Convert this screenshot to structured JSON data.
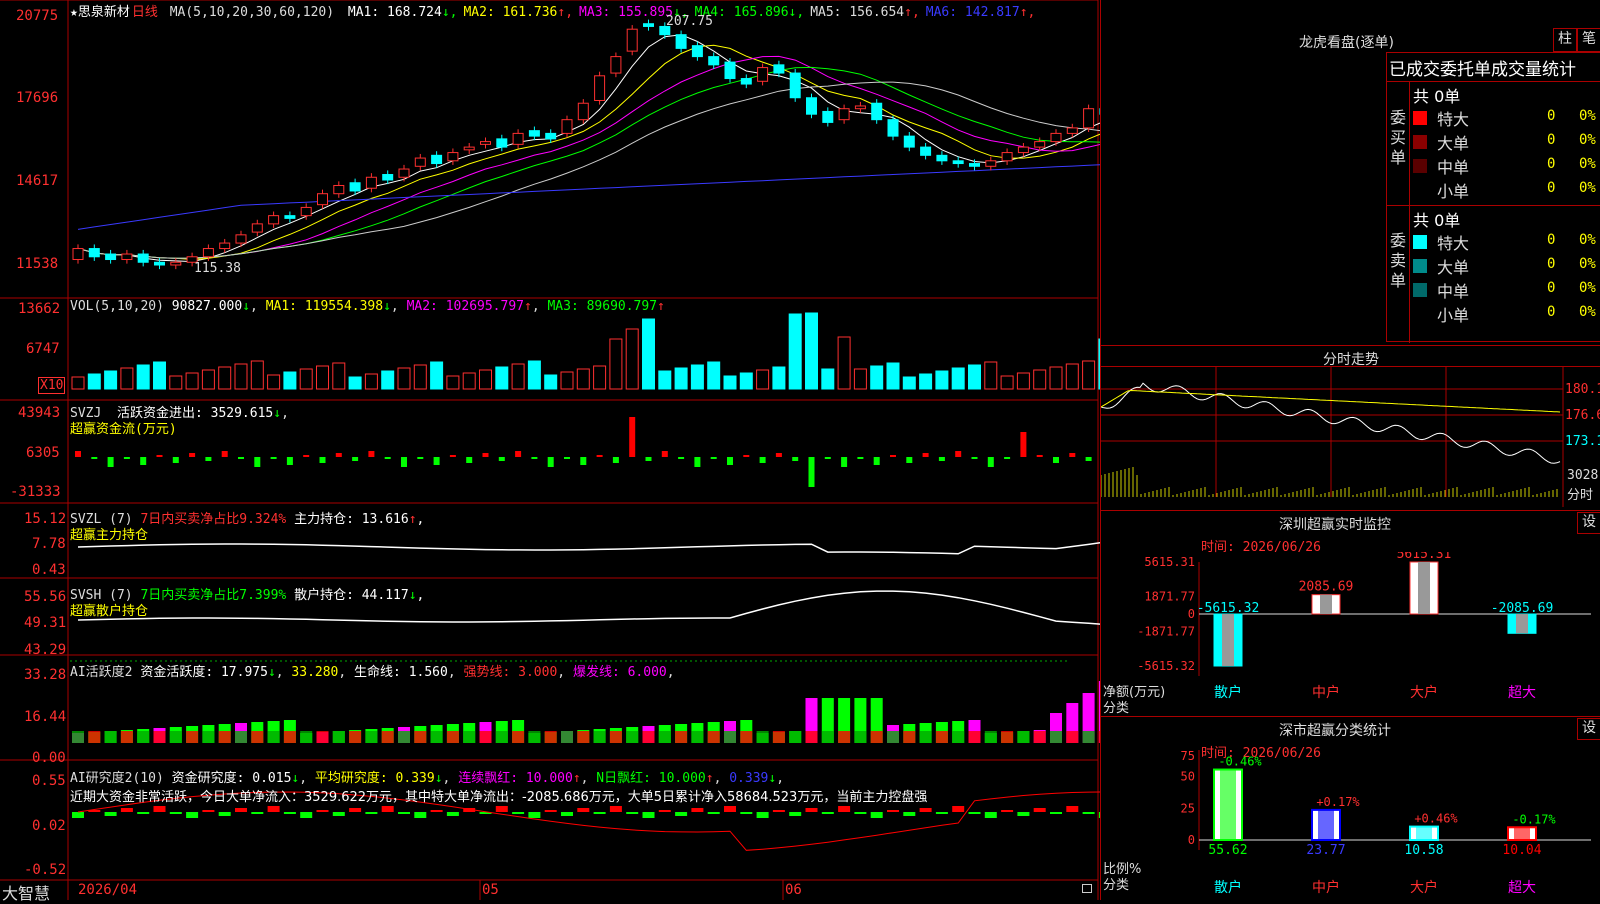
{
  "header": {
    "star": "★",
    "stock_name": "思泉新材",
    "period": "日线",
    "ma_label": "MA(5,10,20,30,60,120)",
    "ma_values": [
      {
        "label": "MA1: 168.724",
        "arrow": "↓",
        "color": "#ffffff"
      },
      {
        "label": "MA2: 161.736",
        "arrow": "↑",
        "color": "#ffff00"
      },
      {
        "label": "MA3: 155.895",
        "arrow": "↓",
        "color": "#ff00ff"
      },
      {
        "label": "MA4: 165.896",
        "arrow": "↓",
        "color": "#00ff00"
      },
      {
        "label": "MA5: 156.654",
        "arrow": "↑",
        "color": "#dddddd"
      },
      {
        "label": "MA6: 142.817",
        "arrow": "↑",
        "color": "#3a3aff"
      }
    ]
  },
  "axes": {
    "price": [
      "20775",
      "17696",
      "14617",
      "11538"
    ],
    "vol": [
      "13662",
      "6747"
    ],
    "vol_unit": "X10",
    "svzj": [
      "43943",
      "6305",
      "-31333"
    ],
    "svzl": [
      "15.12",
      "7.78",
      "0.43"
    ],
    "svsh": [
      "55.56",
      "49.31",
      "43.29"
    ],
    "ai": [
      "33.28",
      "16.44",
      "0.00"
    ],
    "ai2": [
      "0.55",
      "0.02",
      "-0.52"
    ]
  },
  "annotations": {
    "high": "207.75",
    "low": "115.38"
  },
  "panels": {
    "vol": {
      "title": "VOL(5,10,20)",
      "value": "90827.000",
      "arrow": "↓",
      "ma1": "MA1: 119554.398",
      "ma1_arrow": "↓",
      "ma2": "MA2: 102695.797",
      "ma2_arrow": "↑",
      "ma3": "MA3: 89690.797",
      "ma3_arrow": "↑"
    },
    "svzj": {
      "title": "SVZJ",
      "label": "活跃资金进出: 3529.615",
      "arrow": "↓",
      "subtitle": "超赢资金流(万元)"
    },
    "svzl": {
      "title": "SVZL (7)",
      "ratio": "7日内买卖净占比9.324%",
      "label": "主力持仓: 13.616",
      "arrow": "↑",
      "suffix": ",",
      "subtitle": "超赢主力持仓"
    },
    "svsh": {
      "title": "SVSH (7)",
      "ratio": "7日内买卖净占比7.399%",
      "label": "散户持仓: 44.117",
      "arrow": "↓",
      "suffix": ",",
      "subtitle": "超赢散户持仓"
    },
    "ai": {
      "title": "AI活跃度2",
      "a": "资金活跃度: 17.975",
      "a_arrow": "↓",
      "b": "33.280",
      "c": "生命线: 1.560",
      "d": "强势线: 3.000",
      "e": "爆发线: 6.000"
    },
    "ai2": {
      "title": "AI研究度2(10)",
      "a": "资金研究度: 0.015",
      "a_arrow": "↓",
      "b": "平均研究度: 0.339",
      "b_arrow": "↓",
      "c": "连续飘红: 10.000",
      "c_arrow": "↑",
      "d": "N日飘红: 10.000",
      "d_arrow": "↑",
      "e": "0.339",
      "e_arrow": "↓",
      "comment": "近期大资金非常活跃，今日大单净流入：3529.622万元，其中特大单净流出：-2085.686万元，大单5日累计净入58684.523万元，当前主力控盘强"
    }
  },
  "bottom": {
    "brand": "大智慧",
    "date_start": "2026/04",
    "m5": "05",
    "m6": "06"
  },
  "right": {
    "dragon_title": "龙虎看盘(逐单)",
    "btn_bar": "柱",
    "btn_line": "笔",
    "stats_title": "已成交委托单成交量统计",
    "buy_label": "委买单",
    "sell_label": "委卖单",
    "buy_total": "共 0单",
    "sell_total": "共 0单",
    "buy_rows": [
      {
        "name": "特大",
        "count": "0",
        "pct": "0%",
        "color": "#ff0000"
      },
      {
        "name": "大单",
        "count": "0",
        "pct": "0%",
        "color": "#8b0000"
      },
      {
        "name": "中单",
        "count": "0",
        "pct": "0%",
        "color": "#5a0000"
      },
      {
        "name": "小单",
        "count": "0",
        "pct": "0%",
        "color": ""
      }
    ],
    "sell_rows": [
      {
        "name": "特大",
        "count": "0",
        "pct": "0%",
        "color": "#00ffff"
      },
      {
        "name": "大单",
        "count": "0",
        "pct": "0%",
        "color": "#008b8b"
      },
      {
        "name": "中单",
        "count": "0",
        "pct": "0%",
        "color": "#006a6a"
      },
      {
        "name": "小单",
        "count": "0",
        "pct": "0%",
        "color": ""
      }
    ],
    "intraday_title": "分时走势",
    "intraday_axis": [
      "180.1",
      "176.6",
      "173.1"
    ],
    "intraday_vol": "3028",
    "intraday_unit": "分时",
    "sz_title": "深圳超赢实时监控",
    "sz_time": "时间: 2026/06/26",
    "sz_axis": [
      "5615.31",
      "1871.77",
      "0",
      "-1871.77",
      "-5615.32"
    ],
    "sz_ylabel": "净额(万元)",
    "sz_xlabel": "分类",
    "set": "设",
    "cat_title": "深市超赢分类统计",
    "cat_time": "时间: 2026/06/26",
    "cat_axis": [
      "75",
      "50",
      "25",
      "0"
    ],
    "cat_ylabel": "比例%",
    "cat_xlabel": "分类",
    "categories": [
      "散户",
      "中户",
      "大户",
      "超大"
    ]
  },
  "chart_data": [
    {
      "type": "bar",
      "title": "深圳超赢实时监控",
      "categories": [
        "散户",
        "中户",
        "大户",
        "超大"
      ],
      "series": [
        {
          "values": [
            -5615.32,
            2085.69,
            5615.31,
            -2085.69
          ]
        }
      ],
      "value_labels": [
        "-5615.32",
        "2085.69",
        "5615.31",
        "-2085.69"
      ],
      "ylabel": "净额(万元)",
      "ylim": [
        -5615.32,
        5615.31
      ]
    },
    {
      "type": "bar",
      "title": "深市超赢分类统计",
      "categories": [
        "散户",
        "中户",
        "大户",
        "超大"
      ],
      "values": [
        55.62,
        23.77,
        10.58,
        10.04
      ],
      "changes": [
        "-0.46%",
        "+0.17%",
        "+0.46%",
        "-0.17%"
      ],
      "colors": [
        "#00ff00",
        "#0000ff",
        "#00ffff",
        "#ff0000"
      ],
      "ylabel": "比例%",
      "ylim": [
        0,
        75
      ]
    },
    {
      "type": "line",
      "title": "分时走势",
      "y_ticks": [
        180.1,
        176.6,
        173.1
      ]
    }
  ]
}
